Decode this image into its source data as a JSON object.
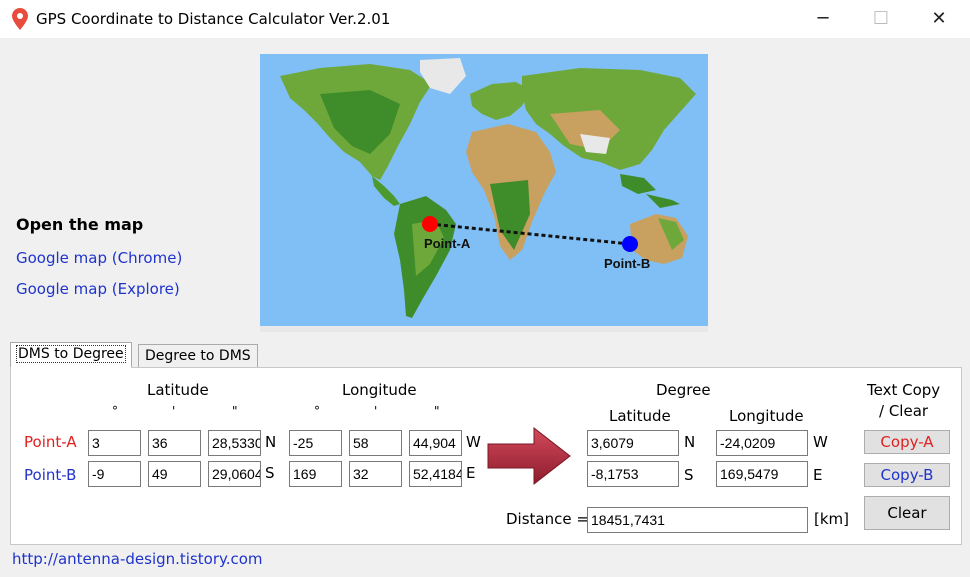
{
  "window": {
    "title": "GPS Coordinate to Distance Calculator Ver.2.01",
    "minimize_glyph": "─",
    "maximize_glyph": "☐",
    "close_glyph": "✕"
  },
  "map": {
    "point_a_label": "Point-A",
    "point_b_label": "Point-B",
    "point_a_color": "#ff0000",
    "point_b_color": "#0000ff",
    "ocean_color": "#80bff5"
  },
  "open_map": {
    "title": "Open the map",
    "google_chrome": "Google map (Chrome)",
    "google_explore": "Google map (Explore)"
  },
  "tabs": [
    {
      "label": "DMS to Degree",
      "active": true
    },
    {
      "label": "Degree to DMS",
      "active": false
    }
  ],
  "dms": {
    "latitude_header": "Latitude",
    "longitude_header": "Longitude",
    "deg_symbol": "°",
    "min_symbol": "'",
    "sec_symbol": "\"",
    "point_a": {
      "label": "Point-A",
      "lat_deg": "3",
      "lat_min": "36",
      "lat_sec": "28,5330",
      "lat_dir": "N",
      "lon_deg": "-25",
      "lon_min": "58",
      "lon_sec": "44,904",
      "lon_dir": "W"
    },
    "point_b": {
      "label": "Point-B",
      "lat_deg": "-9",
      "lat_min": "49",
      "lat_sec": "29,0604",
      "lat_dir": "S",
      "lon_deg": "169",
      "lon_min": "32",
      "lon_sec": "52,4184",
      "lon_dir": "E"
    }
  },
  "degree": {
    "header": "Degree",
    "latitude_header": "Latitude",
    "longitude_header": "Longitude",
    "point_a": {
      "lat": "3,6079",
      "lat_dir": "N",
      "lon": "-24,0209",
      "lon_dir": "W"
    },
    "point_b": {
      "lat": "-8,1753",
      "lat_dir": "S",
      "lon": "169,5479",
      "lon_dir": "E"
    }
  },
  "distance": {
    "label": "Distance =",
    "value": "18451,7431",
    "unit": "[km]"
  },
  "text_copy": {
    "header_line1": "Text Copy",
    "header_line2": "/ Clear",
    "copy_a": "Copy-A",
    "copy_b": "Copy-B",
    "clear": "Clear"
  },
  "footer": {
    "link": "http://antenna-design.tistory.com"
  },
  "colors": {
    "point_a_text": "#e02020",
    "point_b_text": "#1f33cc",
    "arrow": "#b0283a"
  }
}
